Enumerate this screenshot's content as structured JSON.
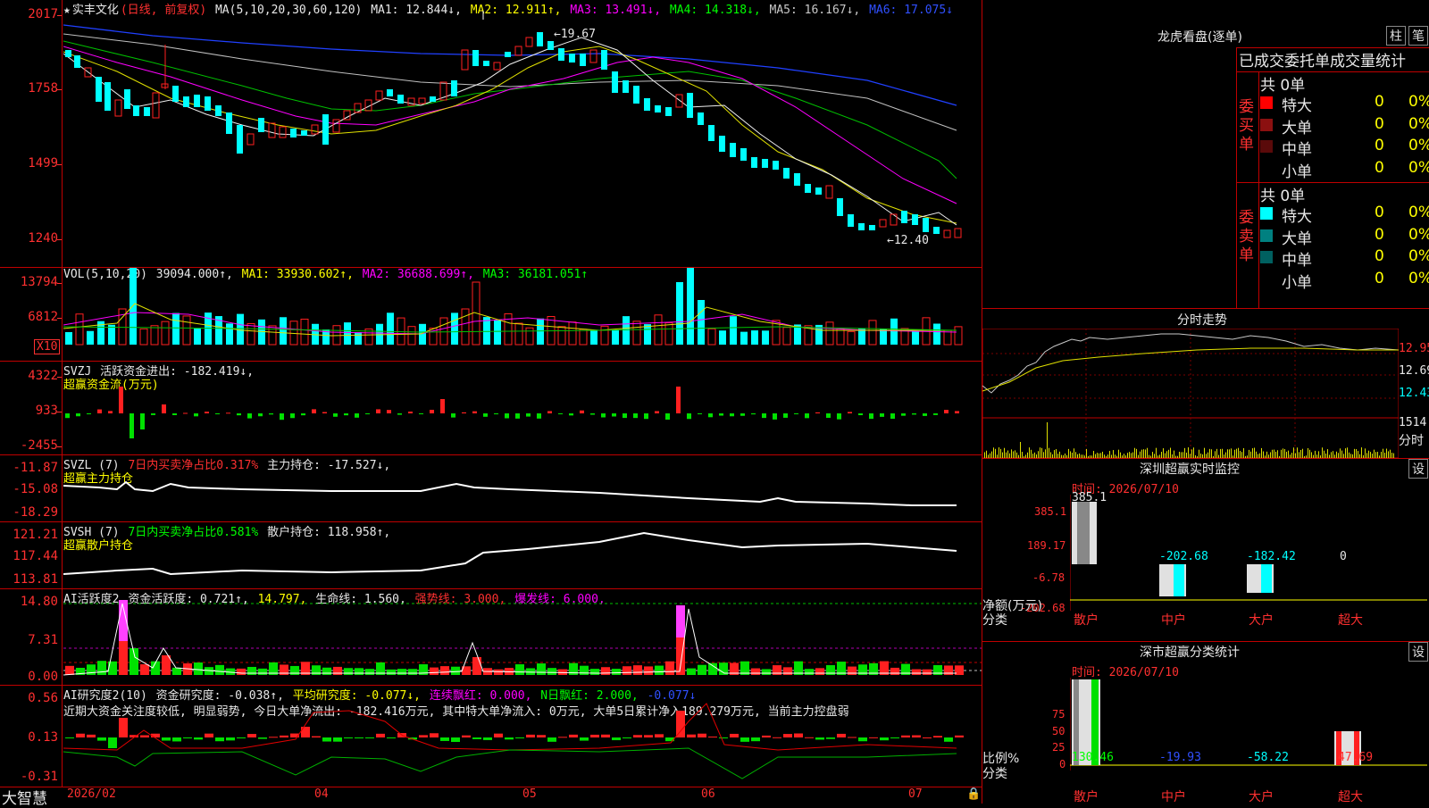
{
  "header": {
    "stock_name": "实丰文化",
    "period": "(日线, 前复权)",
    "ma_label": "MA(5,10,20,30,60,120)",
    "ma1": "MA1: 12.844↓,",
    "ma2": "MA2: 12.911↑,",
    "ma3": "MA3: 13.491↓,",
    "ma4": "MA4: 14.318↓,",
    "ma5": "MA5: 16.167↓,",
    "ma6": "MA6: 17.075↓"
  },
  "price_panel": {
    "y_labels": [
      "2017",
      "1758",
      "1499",
      "1240"
    ],
    "high_label": "19.67",
    "low_label": "12.40"
  },
  "vol_panel": {
    "header": "VOL(5,10,20)",
    "vol_value": "39094.000↑,",
    "ma1": "MA1: 33930.602↑,",
    "ma2": "MA2: 36688.699↑,",
    "ma3": "MA3: 36181.051↑",
    "y_labels": [
      "13794",
      "6812"
    ],
    "unit": "X10"
  },
  "svzj_panel": {
    "header": "SVZJ",
    "value": "活跃资金进出: -182.419↓,",
    "subtitle": "超赢资金流(万元)",
    "y_labels": [
      "4322",
      "933",
      "-2455"
    ]
  },
  "svzl_panel": {
    "header": "SVZL (7)",
    "ratio": "7日内买卖净占比0.317%",
    "value": "主力持仓: -17.527↓,",
    "subtitle": "超赢主力持仓",
    "y_labels": [
      "-11.87",
      "-15.08",
      "-18.29"
    ]
  },
  "svsh_panel": {
    "header": "SVSH (7)",
    "ratio": "7日内买卖净占比0.581%",
    "value": "散户持仓: 118.958↑,",
    "subtitle": "超赢散户持仓",
    "y_labels": [
      "121.21",
      "117.44",
      "113.81"
    ]
  },
  "ai_active_panel": {
    "header": "AI活跃度2",
    "v1": "资金活跃度: 0.721↑,",
    "v2": "14.797,",
    "v3": "生命线: 1.560,",
    "v4": "强势线: 3.000,",
    "v5": "爆发线: 6.000,",
    "y_labels": [
      "14.80",
      "7.31",
      "0.00"
    ]
  },
  "ai_research_panel": {
    "header": "AI研究度2(10)",
    "v1": "资金研究度: -0.038↑,",
    "v2": "平均研究度: -0.077↓,",
    "v3": "连续飘红: 0.000,",
    "v4": "N日飘红: 2.000,",
    "v5": "-0.077↓",
    "comment": "近期大资金关注度较低, 明显弱势, 今日大单净流出: -182.416万元, 其中特大单净流入: 0万元, 大单5日累计净入189.279万元, 当前主力控盘弱",
    "y_labels": [
      "0.56",
      "0.13",
      "-0.31"
    ]
  },
  "xaxis": {
    "brand": "大智慧",
    "labels": [
      "2026/02",
      "04",
      "05",
      "06",
      "07"
    ]
  },
  "dragon": {
    "title": "龙虎看盘(逐单)",
    "btn1": "柱",
    "btn2": "笔",
    "subtitle": "已成交委托单成交量统计",
    "buy_label": "委买单",
    "sell_label": "委卖单",
    "buy_total": "共 0单",
    "sell_total": "共 0单",
    "rows": [
      {
        "name": "特大",
        "count": "0",
        "pct": "0%"
      },
      {
        "name": "大单",
        "count": "0",
        "pct": "0%"
      },
      {
        "name": "中单",
        "count": "0",
        "pct": "0%"
      },
      {
        "name": "小单",
        "count": "0",
        "pct": "0%"
      }
    ],
    "buy_colors": [
      "#ff0000",
      "#8b1010",
      "#5a0a0a",
      "#000000"
    ],
    "sell_colors": [
      "#00ffff",
      "#008080",
      "#006060",
      "#000000"
    ]
  },
  "intraday": {
    "title": "分时走势",
    "y_labels": [
      "12.95",
      "12.69",
      "12.43"
    ],
    "vol_label": "1514",
    "time_label": "分时"
  },
  "sz_monitor": {
    "title": "深圳超赢实时监控",
    "btn": "设",
    "date": "时间: 2026/07/10",
    "y_labels": [
      "385.1",
      "189.17",
      "-6.78",
      "-202.68"
    ],
    "top_value": "385.1",
    "values": [
      "-202.68",
      "-182.42",
      "0"
    ],
    "axis_title": "净额(万元)",
    "axis_sub": "分类",
    "categories": [
      "散户",
      "中户",
      "大户",
      "超大"
    ]
  },
  "sz_classify": {
    "title": "深市超赢分类统计",
    "btn": "设",
    "date": "时间: 2026/07/10",
    "y_labels": [
      "75",
      "50",
      "25",
      "0"
    ],
    "values": [
      "130.46",
      "-19.93",
      "-58.22",
      "47.69"
    ],
    "axis_title": "比例%",
    "axis_sub": "分类",
    "categories": [
      "散户",
      "中户",
      "大户",
      "超大"
    ]
  }
}
